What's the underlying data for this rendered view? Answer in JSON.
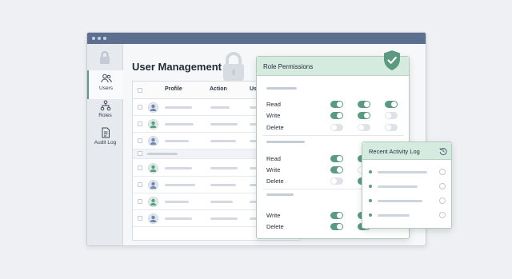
{
  "app": {
    "title": "User Management",
    "sidebar": {
      "items": [
        {
          "label": "Users",
          "icon": "users-icon",
          "active": true
        },
        {
          "label": "Roles",
          "icon": "roles-icon",
          "active": false
        },
        {
          "label": "Audit Log",
          "icon": "audit-log-icon",
          "active": false
        }
      ]
    },
    "table": {
      "columns": [
        "Profile",
        "Action",
        "Us"
      ],
      "rows": [
        {
          "avatar": "avatar-icon",
          "avatar_color": "#6f86ad"
        },
        {
          "avatar": "avatar-icon",
          "avatar_color": "#5d9b86"
        },
        {
          "avatar": "avatar-icon",
          "avatar_color": "#6f86ad"
        },
        {
          "avatar": "avatar-icon",
          "avatar_color": "#5d9b86"
        },
        {
          "avatar": "avatar-icon",
          "avatar_color": "#6f86ad"
        },
        {
          "avatar": "avatar-icon",
          "avatar_color": "#5d9b86"
        },
        {
          "avatar": "avatar-icon",
          "avatar_color": "#6f86ad"
        }
      ]
    }
  },
  "role_permissions": {
    "title": "Role Permissions",
    "groups": [
      {
        "rows": [
          {
            "label": "Read",
            "toggles": [
              true,
              true,
              true
            ]
          },
          {
            "label": "Write",
            "toggles": [
              true,
              true,
              false
            ]
          },
          {
            "label": "Delete",
            "toggles": [
              false,
              false,
              false
            ]
          }
        ]
      },
      {
        "rows": [
          {
            "label": "Read",
            "toggles": [
              true,
              true
            ]
          },
          {
            "label": "Write",
            "toggles": [
              true,
              false
            ]
          },
          {
            "label": "Delete",
            "toggles": [
              false,
              true
            ]
          }
        ]
      },
      {
        "rows": [
          {
            "label": "Write",
            "toggles": [
              true,
              true
            ]
          },
          {
            "label": "Delete",
            "toggles": [
              true,
              true
            ]
          }
        ]
      }
    ]
  },
  "activity_log": {
    "title": "Recent Activity Log",
    "entries": 4
  },
  "colors": {
    "accent": "#5d9b86",
    "titlebar": "#5d6f8f",
    "panel_header": "#d6ebdf"
  }
}
